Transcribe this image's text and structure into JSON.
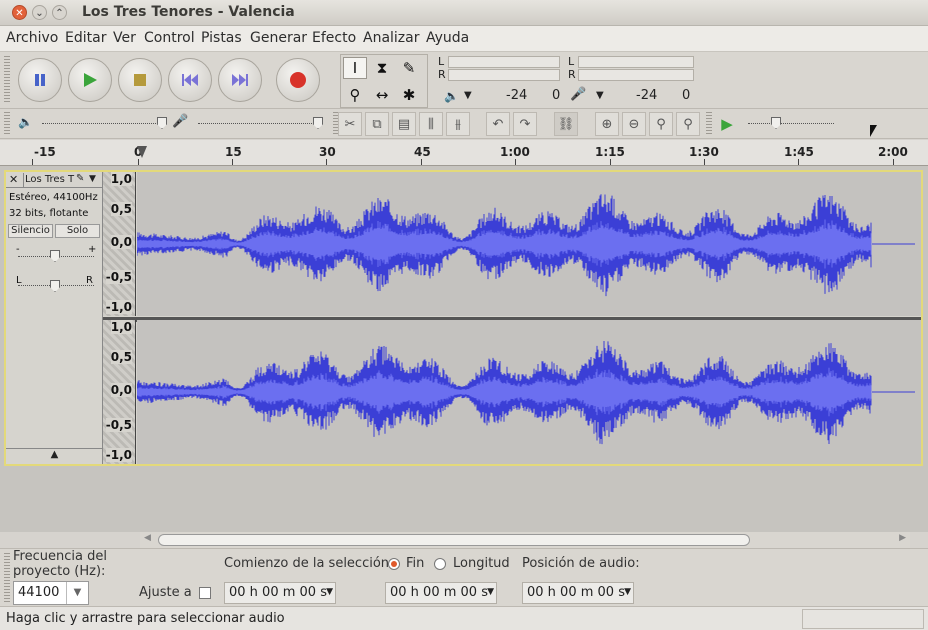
{
  "window": {
    "title": "Los Tres Tenores - Valencia"
  },
  "menu": [
    "Archivo",
    "Editar",
    "Ver",
    "Control",
    "Pistas",
    "Generar",
    "Efecto",
    "Analizar",
    "Ayuda"
  ],
  "transport": {
    "pause": "pause-icon",
    "play": "play-icon",
    "stop": "stop-icon",
    "skip_start": "skip-start-icon",
    "skip_end": "skip-end-icon",
    "record": "record-icon"
  },
  "meters": {
    "out_l": "L",
    "out_r": "R",
    "in_l": "L",
    "in_r": "R",
    "out_db": "-24",
    "out_zero": "0",
    "in_db": "-24",
    "in_zero": "0"
  },
  "ruler": {
    "ticks": [
      "-15",
      "0",
      "15",
      "30",
      "45",
      "1:00",
      "1:15",
      "1:30",
      "1:45",
      "2:00"
    ]
  },
  "track": {
    "name": "Los Tres T",
    "info1": "Estéreo, 44100Hz",
    "info2": "32 bits, flotante",
    "mute": "Silencio",
    "solo": "Solo",
    "gain_minus": "-",
    "gain_plus": "+",
    "pan_l": "L",
    "pan_r": "R",
    "scale": [
      "1,0",
      "0,5",
      "0,0",
      "-0,5",
      "-1,0"
    ]
  },
  "selection": {
    "rate_label": "Frecuencia del proyecto (Hz):",
    "rate_value": "44100",
    "snap_label": "Ajuste a",
    "start_label": "Comienzo de la selección:",
    "end_label": "Fin",
    "length_label": "Longitud",
    "audio_pos_label": "Posición de audio:",
    "t1": "00 h 00 m 00 s",
    "t2": "00 h 00 m 00 s",
    "t3": "00 h 00 m 00 s"
  },
  "status": {
    "message": "Haga clic y arrastre para seleccionar audio"
  },
  "colors": {
    "wave": "#3b3fd6",
    "wave_rms": "#6b6ff0",
    "track_border": "#e3d97a",
    "record": "#d8332a"
  }
}
